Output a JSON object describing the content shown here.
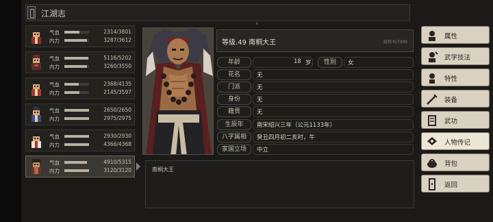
{
  "title": "江湖志",
  "party": [
    {
      "hp": "2314/3801",
      "mp": "3287/3612",
      "hp_fill": 0.61,
      "mp_fill": 0.91,
      "hp_label": "气血",
      "mp_label": "内力"
    },
    {
      "hp": "5116/5202",
      "mp": "3260/3550",
      "hp_fill": 0.98,
      "mp_fill": 0.92,
      "hp_label": "气血",
      "mp_label": "内力"
    },
    {
      "hp": "2368/4135",
      "mp": "2145/3597",
      "hp_fill": 0.57,
      "mp_fill": 0.6,
      "hp_label": "气血",
      "mp_label": "内力"
    },
    {
      "hp": "2650/2650",
      "mp": "2975/2975",
      "hp_fill": 1.0,
      "mp_fill": 1.0,
      "hp_label": "气血",
      "mp_label": "内力"
    },
    {
      "hp": "2930/2930",
      "mp": "4366/4368",
      "hp_fill": 1.0,
      "mp_fill": 1.0,
      "hp_label": "气血",
      "mp_label": "内力"
    },
    {
      "hp": "4910/5315",
      "mp": "3120/3120",
      "hp_fill": 0.92,
      "mp_fill": 1.0,
      "hp_label": "气血",
      "mp_label": "内力"
    }
  ],
  "character": {
    "name_line": "等级.49 南桐大王",
    "exp": "经验:0/7300",
    "age_label": "年龄",
    "age": "18",
    "age_unit": "岁",
    "gender_label": "性别",
    "gender": "女",
    "fields": [
      {
        "label": "花名",
        "value": "无"
      },
      {
        "label": "门派",
        "value": "无"
      },
      {
        "label": "身份",
        "value": "无"
      },
      {
        "label": "籍贯",
        "value": "无"
      },
      {
        "label": "生辰年",
        "value": "南宋绍兴三年（公元1133年）"
      },
      {
        "label": "八字属相",
        "value": "癸丑四月初二亥时，牛"
      },
      {
        "label": "家国立场",
        "value": "中立"
      }
    ]
  },
  "bio": "南桐大王",
  "menu": [
    {
      "label": "属性",
      "icon": "attribute-icon"
    },
    {
      "label": "武学技法",
      "icon": "martial-skill-icon"
    },
    {
      "label": "特性",
      "icon": "trait-icon"
    },
    {
      "label": "装备",
      "icon": "equipment-icon"
    },
    {
      "label": "武功",
      "icon": "kungfu-icon"
    },
    {
      "label": "人物传记",
      "icon": "biography-icon"
    },
    {
      "label": "背包",
      "icon": "bag-icon"
    },
    {
      "label": "返回",
      "icon": "return-icon"
    }
  ],
  "colors": {
    "menu_bg": "#d9d2c1",
    "panel_bg": "#1e1d1a",
    "accent_border": "#6b6555"
  }
}
